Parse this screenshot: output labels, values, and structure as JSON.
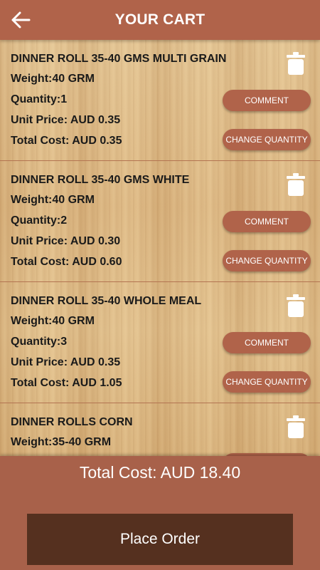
{
  "header": {
    "title": "YOUR CART",
    "back_icon": "arrow-left-icon"
  },
  "buttons": {
    "comment": "COMMENT",
    "change_quantity": "CHANGE QUANTITY"
  },
  "items": [
    {
      "name": "DINNER ROLL 35-40 GMS MULTI GRAIN",
      "weight": "Weight:40 GRM",
      "quantity": "Quantity:1",
      "unit_price": "Unit Price: AUD 0.35",
      "total_cost": "Total Cost: AUD 0.35"
    },
    {
      "name": "DINNER ROLL 35-40 GMS WHITE",
      "weight": "Weight:40 GRM",
      "quantity": "Quantity:2",
      "unit_price": "Unit Price: AUD 0.30",
      "total_cost": "Total Cost: AUD 0.60"
    },
    {
      "name": "DINNER ROLL 35-40 WHOLE MEAL",
      "weight": "Weight:40 GRM",
      "quantity": "Quantity:3",
      "unit_price": "Unit Price: AUD 0.35",
      "total_cost": "Total Cost: AUD 1.05"
    },
    {
      "name": "DINNER ROLLS CORN",
      "weight": "Weight:35-40  GRM",
      "quantity": "",
      "unit_price": "",
      "total_cost": ""
    }
  ],
  "footer": {
    "total": "Total Cost: AUD 18.40",
    "place_order": "Place Order"
  },
  "colors": {
    "primary": "#b0634a",
    "dark": "#55301f",
    "text": "#1a1a1a"
  }
}
